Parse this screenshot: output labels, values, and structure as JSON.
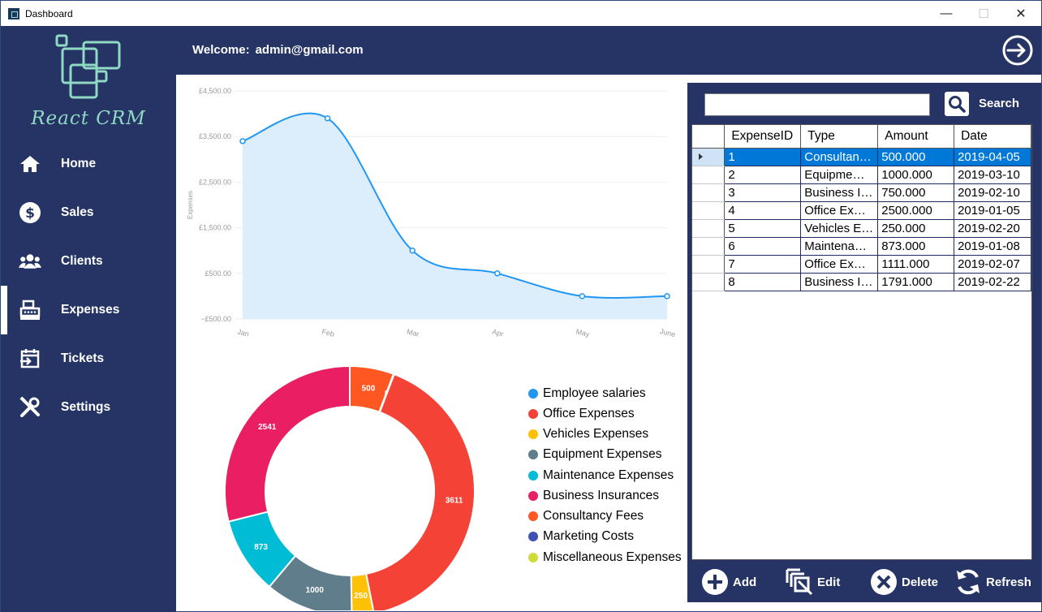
{
  "window": {
    "title": "Dashboard",
    "minimize": "—",
    "maximize": "☐",
    "close": "✕"
  },
  "sidebar": {
    "brand": "React CRM",
    "items": [
      {
        "label": "Home",
        "icon": "home-icon"
      },
      {
        "label": "Sales",
        "icon": "dollar-icon"
      },
      {
        "label": "Clients",
        "icon": "users-icon"
      },
      {
        "label": "Expenses",
        "icon": "cash-register-icon",
        "active": true
      },
      {
        "label": "Tickets",
        "icon": "calendar-import-icon"
      },
      {
        "label": "Settings",
        "icon": "tools-icon"
      }
    ]
  },
  "header": {
    "welcome_label": "Welcome:",
    "user_email": "admin@gmail.com",
    "logout_icon": "logout-icon"
  },
  "colors": {
    "navy": "#253464",
    "accent_teal": "#8fd9c5",
    "line": "#2196f3",
    "area": "#dceefb",
    "selection": "#0078d7"
  },
  "chart_data": [
    {
      "type": "area",
      "categories": [
        "Jan",
        "Feb",
        "Mar",
        "Apr",
        "May",
        "June"
      ],
      "values": [
        3400,
        3900,
        1000,
        500,
        0,
        0
      ],
      "ylabel": "Expenses",
      "ylim": [
        -500,
        4500
      ],
      "yticks": [
        "£4,500.00",
        "£3,500.00",
        "£2,500.00",
        "£1,500.00",
        "£500.00",
        "−£500.00"
      ],
      "grid": true
    },
    {
      "type": "pie",
      "donut": true,
      "slices": [
        {
          "label": "Consultancy Fees",
          "value": 500,
          "color": "#ff5722"
        },
        {
          "label": "Marketing Costs",
          "value": 8,
          "color": "#3f51b5",
          "display": "8"
        },
        {
          "label": "Office Expenses",
          "value": 3611,
          "color": "#f44336"
        },
        {
          "label": "Vehicles Expenses",
          "value": 250,
          "color": "#ffc107"
        },
        {
          "label": "Equipment Expenses",
          "value": 1000,
          "color": "#607d8b"
        },
        {
          "label": "Maintenance Expenses",
          "value": 873,
          "color": "#00bcd4"
        },
        {
          "label": "Business Insurances",
          "value": 2541,
          "color": "#e91e63"
        }
      ],
      "legend": [
        {
          "label": "Employee salaries",
          "color": "#2196f3"
        },
        {
          "label": "Office Expenses",
          "color": "#f44336"
        },
        {
          "label": "Vehicles Expenses",
          "color": "#ffc107"
        },
        {
          "label": "Equipment Expenses",
          "color": "#607d8b"
        },
        {
          "label": "Maintenance Expenses",
          "color": "#00bcd4"
        },
        {
          "label": "Business Insurances",
          "color": "#e91e63"
        },
        {
          "label": "Consultancy Fees",
          "color": "#ff5722"
        },
        {
          "label": "Marketing Costs",
          "color": "#3f51b5"
        },
        {
          "label": "Miscellaneous Expenses",
          "color": "#cddc39"
        }
      ],
      "legend_position": "right"
    }
  ],
  "table": {
    "search_value": "",
    "search_label": "Search",
    "columns": [
      "ExpenseID",
      "Type",
      "Amount",
      "Date"
    ],
    "rows": [
      [
        "1",
        "Consultan…",
        "500.000",
        "2019-04-05"
      ],
      [
        "2",
        "Equipme…",
        "1000.000",
        "2019-03-10"
      ],
      [
        "3",
        "Business I…",
        "750.000",
        "2019-02-10"
      ],
      [
        "4",
        "Office Ex…",
        "2500.000",
        "2019-01-05"
      ],
      [
        "5",
        "Vehicles E…",
        "250.000",
        "2019-02-20"
      ],
      [
        "6",
        "Maintena…",
        "873.000",
        "2019-01-08"
      ],
      [
        "7",
        "Office Ex…",
        "1111.000",
        "2019-02-07"
      ],
      [
        "8",
        "Business I…",
        "1791.000",
        "2019-02-22"
      ]
    ],
    "selected_row": 0
  },
  "actions": {
    "add": "Add",
    "edit": "Edit",
    "delete": "Delete",
    "refresh": "Refresh"
  }
}
